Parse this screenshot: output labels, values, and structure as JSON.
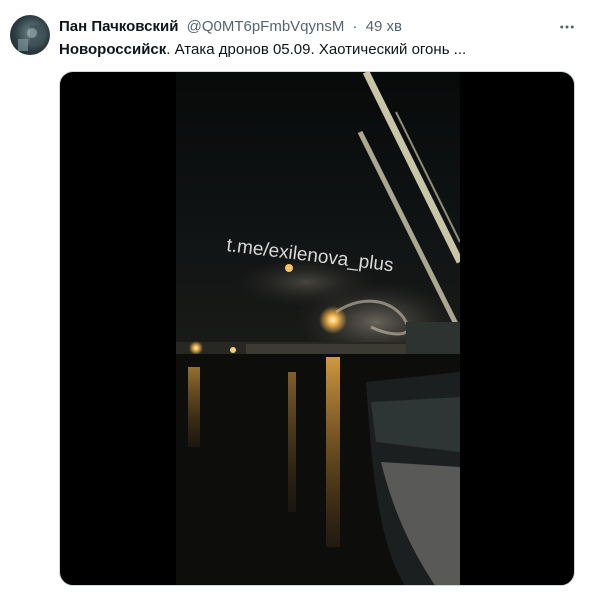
{
  "author": {
    "name": "Пан Пачковский",
    "handle": "@Q0MT6pFmbVqynsM",
    "separator": "·",
    "time": "49 хв"
  },
  "tweet": {
    "text_bold": "Новороссийск",
    "text_rest": ". Атака дронов 05.09. Хаотический огонь ..."
  },
  "media": {
    "watermark": "t.me/exilenova_plus"
  },
  "icons": {
    "more": "more-horizontal-icon"
  }
}
